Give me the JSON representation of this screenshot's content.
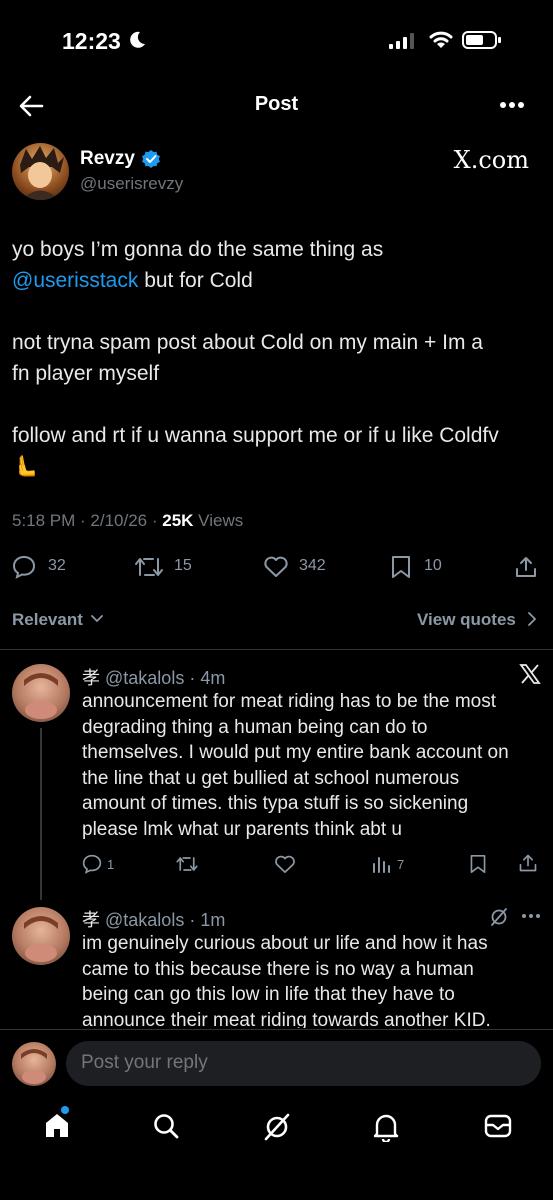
{
  "status_bar": {
    "time": "12:23",
    "moon_icon": "moon-icon"
  },
  "header": {
    "title": "Post"
  },
  "post": {
    "author_name": "Revzy",
    "author_handle": "@userisrevzy",
    "source": "X.com",
    "text_line1": "yo boys I’m gonna do the same thing as",
    "mention": "@userisstack",
    "text_line2_rest": " but for Cold",
    "para2_line1": "not tryna spam post about Cold on my main + Im a",
    "para2_line2": "fn player myself",
    "para3_line1": "follow and rt if u wanna support me or if u like Coldfv",
    "emoji": "🫷",
    "time": "5:18 PM",
    "date": "2/10/26",
    "views": "25K",
    "views_label": " Views",
    "replies": "32",
    "reposts": "15",
    "likes": "342",
    "bookmarks": "10"
  },
  "sort": {
    "relevant": "Relevant",
    "view_quotes": "View quotes"
  },
  "replies": [
    {
      "name": "孝",
      "handle": "@takalols",
      "time": "4m",
      "lines": [
        "announcement for meat riding has to be the most",
        "degrading thing a human being can do to",
        "themselves. I would put my entire bank account on",
        "the line that u get bullied at school numerous",
        "amount of times. this typa stuff is so sickening",
        "please lmk what ur parents think abt u"
      ],
      "reply_count": "1",
      "views": "7"
    },
    {
      "name": "孝",
      "handle": "@takalols",
      "time": "1m",
      "lines": [
        "im genuinely curious  about ur life and how it has",
        "came to this because there is no way a human",
        "being can go this low in life that they have to",
        "announce their meat riding towards another KID."
      ]
    }
  ],
  "composer": {
    "placeholder": "Post your reply"
  },
  "colors": {
    "accent": "#1d9bf0",
    "background": "#000000",
    "muted": "#71767b"
  }
}
